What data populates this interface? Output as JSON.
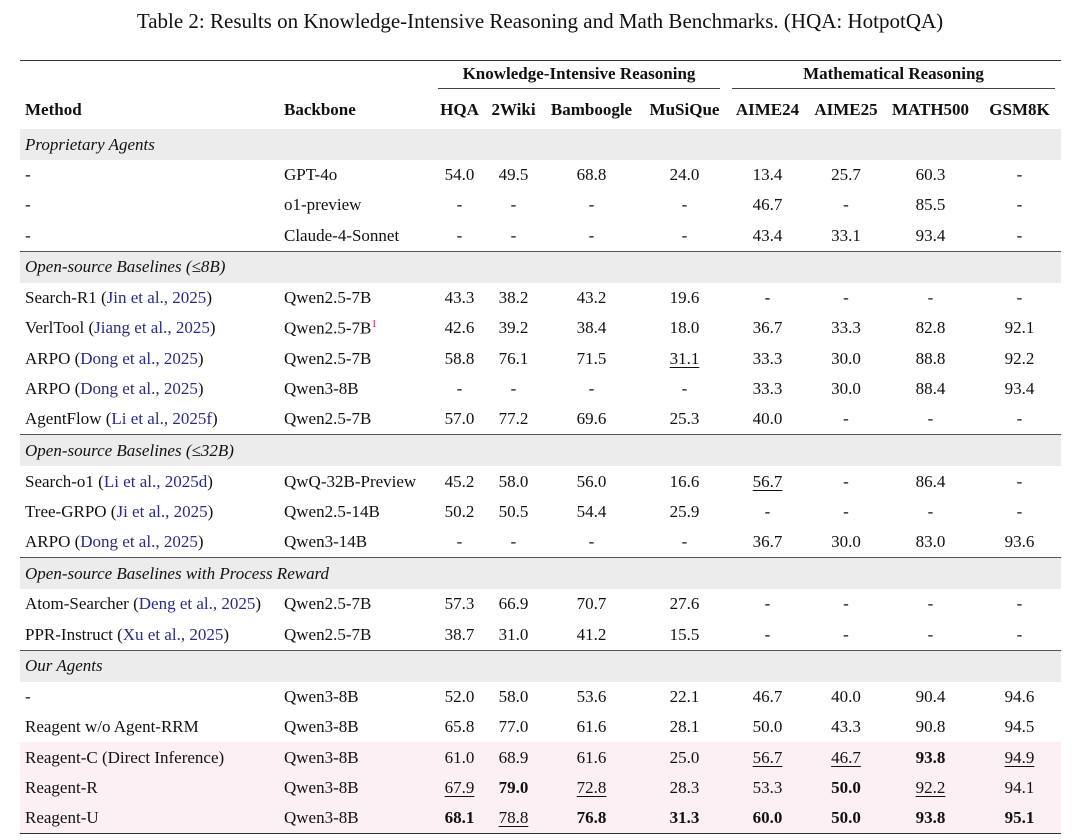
{
  "caption": "Table 2: Results on Knowledge-Intensive Reasoning and Math Benchmarks. (HQA: HotpotQA)",
  "groups": {
    "knowledge": "Knowledge-Intensive Reasoning",
    "math": "Mathematical Reasoning"
  },
  "columns": {
    "method": "Method",
    "backbone": "Backbone",
    "hqa": "HQA",
    "wiki": "2Wiki",
    "bamboogle": "Bamboogle",
    "musique": "MuSiQue",
    "aime24": "AIME24",
    "aime25": "AIME25",
    "math500": "MATH500",
    "gsm8k": "GSM8K"
  },
  "sections": [
    {
      "title": "Proprietary Agents",
      "rows": [
        {
          "name": "-",
          "cite": "",
          "suffix": "",
          "backbone": "GPT-4o",
          "sup": "",
          "vals": [
            "54.0",
            "49.5",
            "68.8",
            "24.0",
            "13.4",
            "25.7",
            "60.3",
            "-"
          ],
          "fmt": [
            "",
            "",
            "",
            "",
            "",
            "",
            "",
            ""
          ]
        },
        {
          "name": "-",
          "cite": "",
          "suffix": "",
          "backbone": "o1-preview",
          "sup": "",
          "vals": [
            "-",
            "-",
            "-",
            "-",
            "46.7",
            "-",
            "85.5",
            "-"
          ],
          "fmt": [
            "",
            "",
            "",
            "",
            "",
            "",
            "",
            ""
          ]
        },
        {
          "name": "-",
          "cite": "",
          "suffix": "",
          "backbone": "Claude-4-Sonnet",
          "sup": "",
          "vals": [
            "-",
            "-",
            "-",
            "-",
            "43.4",
            "33.1",
            "93.4",
            "-"
          ],
          "fmt": [
            "",
            "",
            "",
            "",
            "",
            "",
            "",
            ""
          ]
        }
      ]
    },
    {
      "title": "Open-source Baselines (≤8B)",
      "rows": [
        {
          "name": "Search-R1 (",
          "cite": "Jin et al., 2025",
          "suffix": ")",
          "backbone": "Qwen2.5-7B",
          "sup": "",
          "vals": [
            "43.3",
            "38.2",
            "43.2",
            "19.6",
            "-",
            "-",
            "-",
            "-"
          ],
          "fmt": [
            "",
            "",
            "",
            "",
            "",
            "",
            "",
            ""
          ]
        },
        {
          "name": "VerlTool (",
          "cite": "Jiang et al., 2025",
          "suffix": ")",
          "backbone": "Qwen2.5-7B",
          "sup": "1",
          "vals": [
            "42.6",
            "39.2",
            "38.4",
            "18.0",
            "36.7",
            "33.3",
            "82.8",
            "92.1"
          ],
          "fmt": [
            "",
            "",
            "",
            "",
            "",
            "",
            "",
            ""
          ]
        },
        {
          "name": "ARPO (",
          "cite": "Dong et al., 2025",
          "suffix": ")",
          "backbone": "Qwen2.5-7B",
          "sup": "",
          "vals": [
            "58.8",
            "76.1",
            "71.5",
            "31.1",
            "33.3",
            "30.0",
            "88.8",
            "92.2"
          ],
          "fmt": [
            "",
            "",
            "",
            "u",
            "",
            "",
            "",
            ""
          ]
        },
        {
          "name": "ARPO (",
          "cite": "Dong et al., 2025",
          "suffix": ")",
          "backbone": "Qwen3-8B",
          "sup": "",
          "vals": [
            "-",
            "-",
            "-",
            "-",
            "33.3",
            "30.0",
            "88.4",
            "93.4"
          ],
          "fmt": [
            "",
            "",
            "",
            "",
            "",
            "",
            "",
            ""
          ]
        },
        {
          "name": "AgentFlow (",
          "cite": "Li et al., 2025f",
          "suffix": ")",
          "backbone": "Qwen2.5-7B",
          "sup": "",
          "vals": [
            "57.0",
            "77.2",
            "69.6",
            "25.3",
            "40.0",
            "-",
            "-",
            "-"
          ],
          "fmt": [
            "",
            "",
            "",
            "",
            "",
            "",
            "",
            ""
          ]
        }
      ]
    },
    {
      "title": "Open-source Baselines (≤32B)",
      "rows": [
        {
          "name": "Search-o1 (",
          "cite": "Li et al., 2025d",
          "suffix": ")",
          "backbone": "QwQ-32B-Preview",
          "sup": "",
          "vals": [
            "45.2",
            "58.0",
            "56.0",
            "16.6",
            "56.7",
            "-",
            "86.4",
            "-"
          ],
          "fmt": [
            "",
            "",
            "",
            "",
            "u",
            "",
            "",
            ""
          ]
        },
        {
          "name": "Tree-GRPO (",
          "cite": "Ji et al., 2025",
          "suffix": ")",
          "backbone": "Qwen2.5-14B",
          "sup": "",
          "vals": [
            "50.2",
            "50.5",
            "54.4",
            "25.9",
            "-",
            "-",
            "-",
            "-"
          ],
          "fmt": [
            "",
            "",
            "",
            "",
            "",
            "",
            "",
            ""
          ]
        },
        {
          "name": "ARPO (",
          "cite": "Dong et al., 2025",
          "suffix": ")",
          "backbone": "Qwen3-14B",
          "sup": "",
          "vals": [
            "-",
            "-",
            "-",
            "-",
            "36.7",
            "30.0",
            "83.0",
            "93.6"
          ],
          "fmt": [
            "",
            "",
            "",
            "",
            "",
            "",
            "",
            ""
          ]
        }
      ]
    },
    {
      "title": "Open-source Baselines with Process Reward",
      "rows": [
        {
          "name": "Atom-Searcher (",
          "cite": "Deng et al., 2025",
          "suffix": ")",
          "backbone": "Qwen2.5-7B",
          "sup": "",
          "vals": [
            "57.3",
            "66.9",
            "70.7",
            "27.6",
            "-",
            "-",
            "-",
            "-"
          ],
          "fmt": [
            "",
            "",
            "",
            "",
            "",
            "",
            "",
            ""
          ]
        },
        {
          "name": "PPR-Instruct (",
          "cite": "Xu et al., 2025",
          "suffix": ")",
          "backbone": "Qwen2.5-7B",
          "sup": "",
          "vals": [
            "38.7",
            "31.0",
            "41.2",
            "15.5",
            "-",
            "-",
            "-",
            "-"
          ],
          "fmt": [
            "",
            "",
            "",
            "",
            "",
            "",
            "",
            ""
          ]
        }
      ]
    },
    {
      "title": "Our Agents",
      "rows": [
        {
          "name": "-",
          "cite": "",
          "suffix": "",
          "backbone": "Qwen3-8B",
          "sup": "",
          "vals": [
            "52.0",
            "58.0",
            "53.6",
            "22.1",
            "46.7",
            "40.0",
            "90.4",
            "94.6"
          ],
          "fmt": [
            "",
            "",
            "",
            "",
            "",
            "",
            "",
            ""
          ]
        },
        {
          "name": "Reagent w/o Agent-RRM",
          "cite": "",
          "suffix": "",
          "backbone": "Qwen3-8B",
          "sup": "",
          "vals": [
            "65.8",
            "77.0",
            "61.6",
            "28.1",
            "50.0",
            "43.3",
            "90.8",
            "94.5"
          ],
          "fmt": [
            "",
            "",
            "",
            "",
            "",
            "",
            "",
            ""
          ]
        },
        {
          "name": "Reagent-C (Direct Inference)",
          "cite": "",
          "suffix": "",
          "backbone": "Qwen3-8B",
          "sup": "",
          "pink": true,
          "vals": [
            "61.0",
            "68.9",
            "61.6",
            "25.0",
            "56.7",
            "46.7",
            "93.8",
            "94.9"
          ],
          "fmt": [
            "",
            "",
            "",
            "",
            "u",
            "u",
            "b",
            "u"
          ]
        },
        {
          "name": "Reagent-R",
          "cite": "",
          "suffix": "",
          "backbone": "Qwen3-8B",
          "sup": "",
          "pink": true,
          "vals": [
            "67.9",
            "79.0",
            "72.8",
            "28.3",
            "53.3",
            "50.0",
            "92.2",
            "94.1"
          ],
          "fmt": [
            "u",
            "b",
            "u",
            "",
            "",
            "b",
            "u",
            ""
          ]
        },
        {
          "name": "Reagent-U",
          "cite": "",
          "suffix": "",
          "backbone": "Qwen3-8B",
          "sup": "",
          "pink": true,
          "vals": [
            "68.1",
            "78.8",
            "76.8",
            "31.3",
            "60.0",
            "50.0",
            "93.8",
            "95.1"
          ],
          "fmt": [
            "b",
            "u",
            "b",
            "b",
            "b",
            "b",
            "b",
            "b"
          ]
        }
      ]
    }
  ]
}
